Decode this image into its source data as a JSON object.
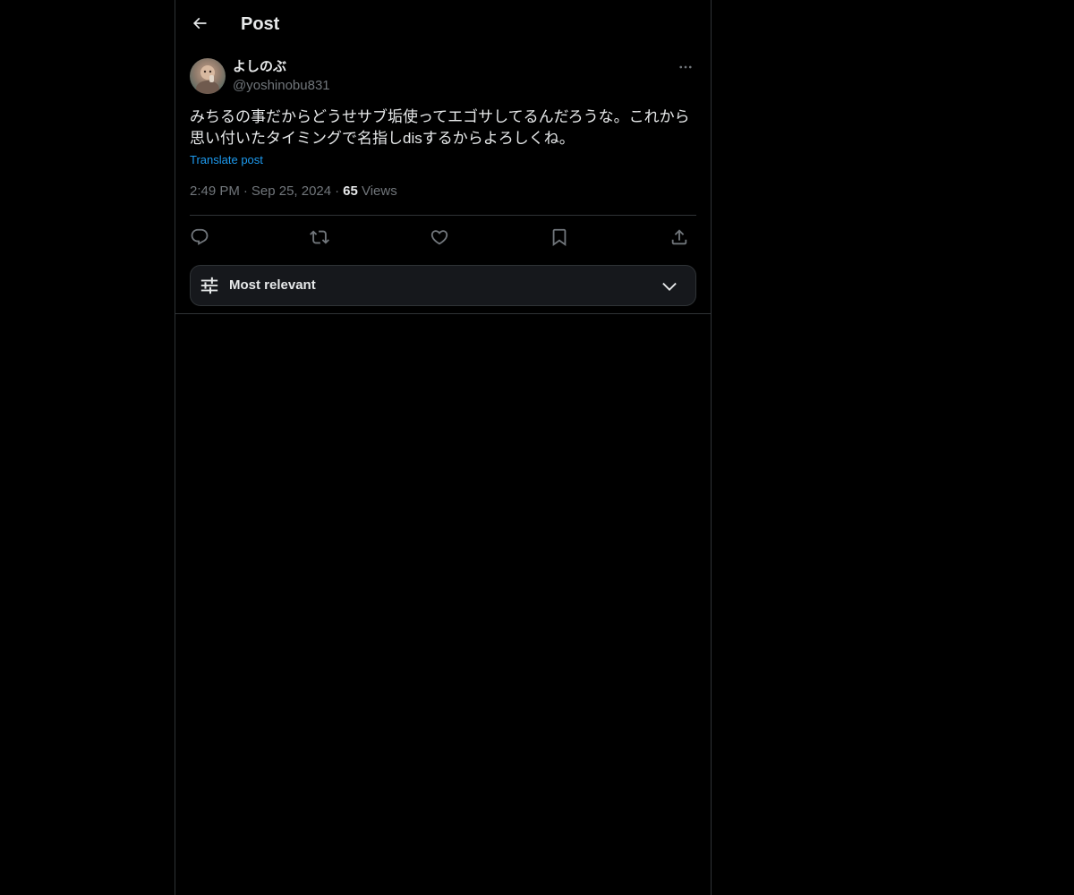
{
  "header": {
    "title": "Post",
    "back_icon": "arrow-left-icon"
  },
  "post": {
    "author": {
      "display_name": "よしのぶ",
      "handle": "@yoshinobu831"
    },
    "more_icon": "more-horizontal-icon",
    "text": "みちるの事だからどうせサブ垢使ってエゴサしてるんだろうな。これから\n思い付いたタイミングで名指しdisするからよろしくね。",
    "translate_label": "Translate post",
    "time": "2:49 PM",
    "date": "Sep 25, 2024",
    "separator": "·",
    "views_count": "65",
    "views_label": "Views"
  },
  "actions": {
    "reply_icon": "reply-icon",
    "repost_icon": "repost-icon",
    "like_icon": "heart-icon",
    "bookmark_icon": "bookmark-icon",
    "share_icon": "share-icon"
  },
  "replies_sort": {
    "label": "Most relevant",
    "filter_icon": "sliders-icon",
    "chevron_icon": "chevron-down-icon"
  },
  "colors": {
    "background": "#000000",
    "text_primary": "#e7e9ea",
    "text_secondary": "#71767b",
    "link": "#1d9bf0",
    "border": "#2f3336",
    "sort_bg": "#16181c"
  }
}
